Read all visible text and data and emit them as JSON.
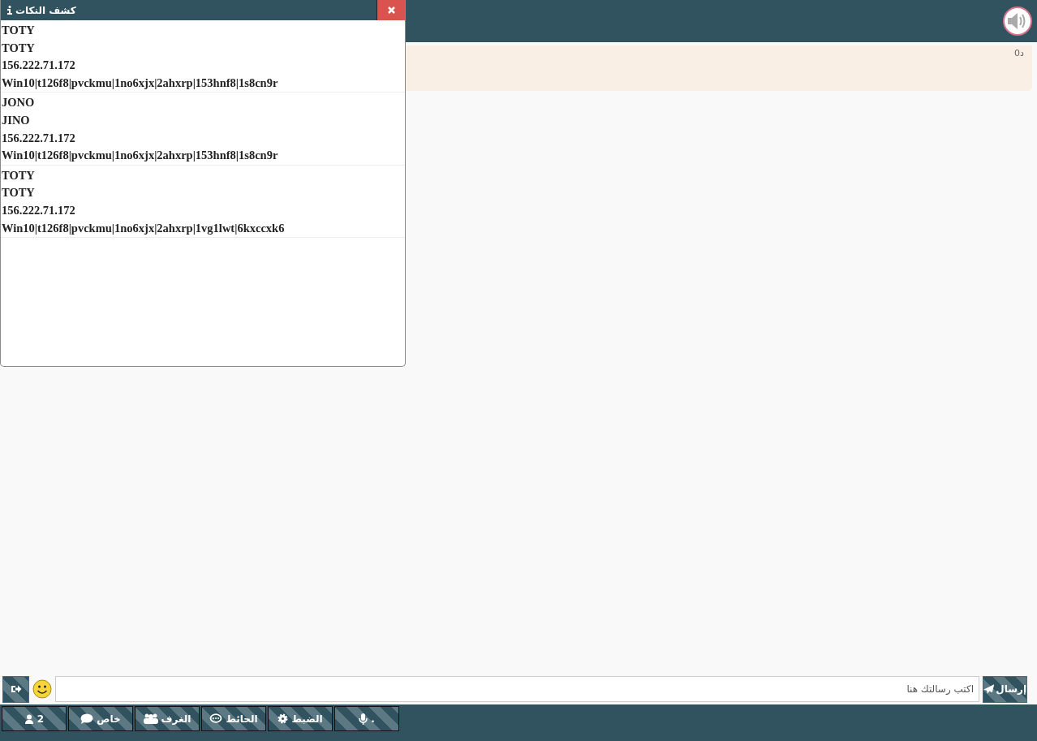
{
  "message": {
    "badge": "0د"
  },
  "popup": {
    "title": "كشف النكات",
    "entries": [
      {
        "lines": [
          "TOTY",
          "TOTY",
          "156.222.71.172",
          "Win10|t126f8|pvckmu|1no6xjx|2ahxrp|153hnf8|1s8cn9r"
        ]
      },
      {
        "lines": [
          "JONO",
          "JINO",
          "156.222.71.172",
          "Win10|t126f8|pvckmu|1no6xjx|2ahxrp|153hnf8|1s8cn9r"
        ]
      },
      {
        "lines": [
          "TOTY",
          "TOTY",
          "156.222.71.172",
          "Win10|t126f8|pvckmu|1no6xjx|2ahxrp|1vg1lwt|6kxccxk6"
        ]
      }
    ]
  },
  "composer": {
    "placeholder": "اكتب رسالتك هنا",
    "send": "إرسال"
  },
  "bottom_bar": [
    {
      "kind": "mic",
      "label": "."
    },
    {
      "kind": "settings",
      "label": "الضبط"
    },
    {
      "kind": "wall",
      "label": "الحائط"
    },
    {
      "kind": "rooms",
      "label": "الغرف"
    },
    {
      "kind": "private",
      "label": "خاص"
    },
    {
      "kind": "users",
      "label": "2"
    }
  ]
}
